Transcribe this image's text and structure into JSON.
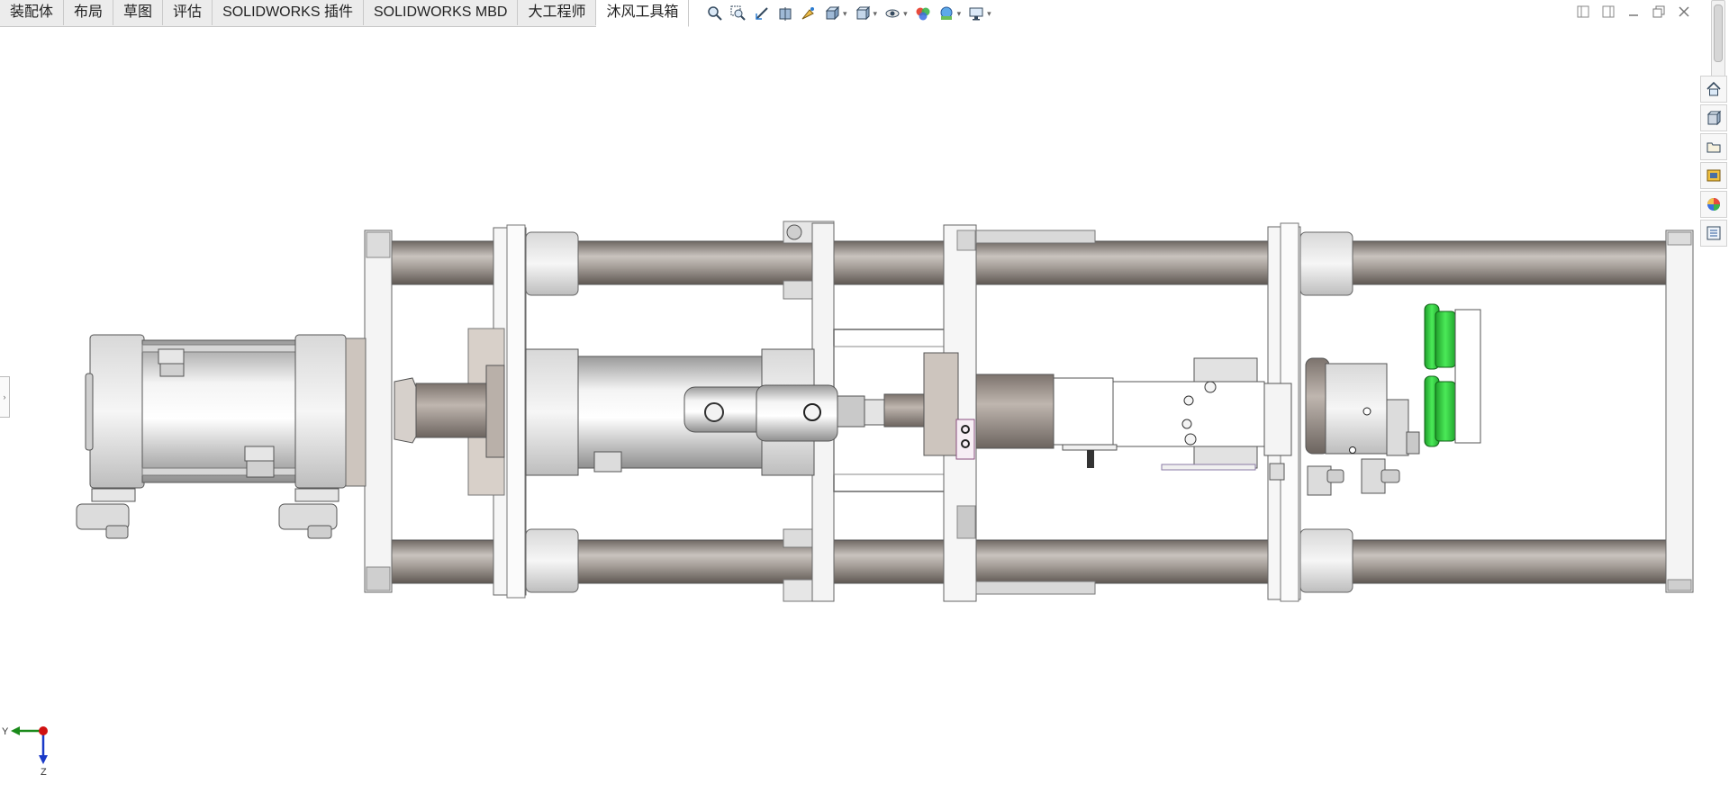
{
  "tabs": [
    {
      "label": "装配体",
      "active": false
    },
    {
      "label": "布局",
      "active": false
    },
    {
      "label": "草图",
      "active": false
    },
    {
      "label": "评估",
      "active": false
    },
    {
      "label": "SOLIDWORKS 插件",
      "active": false
    },
    {
      "label": "SOLIDWORKS MBD",
      "active": false
    },
    {
      "label": "大工程师",
      "active": false
    },
    {
      "label": "沐风工具箱",
      "active": true
    }
  ],
  "toolbar_icons": [
    "zoom-to-fit-icon",
    "zoom-to-area-icon",
    "previous-view-icon",
    "section-view-icon",
    "dynamic-annotation-icon",
    "view-orientation-icon",
    "display-style-icon",
    "hide-show-items-icon",
    "edit-appearance-icon",
    "apply-scene-icon",
    "view-settings-icon"
  ],
  "taskpane_icons": [
    "home-icon",
    "design-library-icon",
    "file-explorer-icon",
    "view-palette-icon",
    "appearances-icon",
    "custom-properties-icon"
  ],
  "triad": {
    "axis_y": "Y",
    "axis_z": "Z"
  },
  "colors": {
    "tab_active": "#ffffff",
    "tab_bg": "#ececec",
    "part_green": "#2ecc3a",
    "rod_gray": "#8c8580",
    "triad_y": "#1a8a1a",
    "triad_z": "#1a3ac8",
    "triad_origin": "#d01010"
  }
}
